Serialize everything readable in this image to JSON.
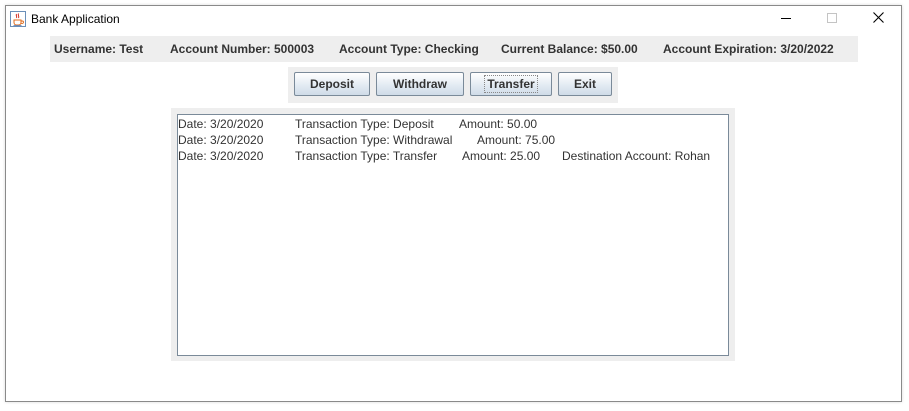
{
  "window": {
    "title": "Bank Application"
  },
  "titlebar_icons": {
    "app": "java-cup-icon",
    "minimize": "minimize-icon",
    "maximize": "maximize-icon",
    "close": "close-icon"
  },
  "account_info": {
    "username": "Username: Test",
    "account_number": "Account Number: 500003",
    "account_type": "Account Type: Checking",
    "current_balance": "Current Balance: $50.00",
    "account_expiration": "Account Expiration: 3/20/2022"
  },
  "actions": {
    "deposit": "Deposit",
    "withdraw": "Withdraw",
    "transfer": "Transfer",
    "exit": "Exit"
  },
  "transactions": [
    {
      "date": "Date: 3/20/2020",
      "type": "Transaction Type: Deposit",
      "amount": "Amount: 50.00",
      "destination": ""
    },
    {
      "date": "Date: 3/20/2020",
      "type": "Transaction Type: Withdrawal",
      "amount": "Amount: 75.00",
      "destination": ""
    },
    {
      "date": "Date: 3/20/2020",
      "type": "Transaction Type: Transfer",
      "amount": "Amount: 25.00",
      "destination": "Destination Account: Rohan"
    }
  ],
  "colors": {
    "panel_background": "#eeeeee",
    "text": "#333333",
    "button_border": "#7a8a99"
  }
}
